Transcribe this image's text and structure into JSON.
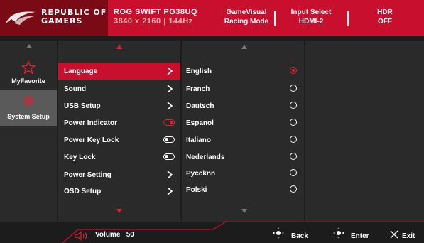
{
  "header": {
    "brand": [
      "REPUBLIC OF",
      "GAMERS"
    ],
    "model": "ROG SWIFT PG38UQ",
    "model_sub": "3840 x 2160 | 144Hz",
    "status": [
      {
        "line1": "GameVisual",
        "line2": "Racing Mode"
      },
      {
        "line1": "Input Select",
        "line2": "HDMI-2"
      },
      {
        "line1": "HDR",
        "line2": "OFF"
      }
    ]
  },
  "categories": [
    {
      "label": "MyFavorite",
      "icon": "star-icon",
      "active": false
    },
    {
      "label": "System Setup",
      "icon": "gear-icon",
      "active": true
    }
  ],
  "menu": [
    {
      "label": "Language",
      "control": "chevron",
      "active": true
    },
    {
      "label": "Sound",
      "control": "chevron"
    },
    {
      "label": "USB Setup",
      "control": "chevron"
    },
    {
      "label": "Power Indicator",
      "control": "toggle",
      "on": true
    },
    {
      "label": "Power Key Lock",
      "control": "toggle",
      "on": false
    },
    {
      "label": "Key Lock",
      "control": "toggle",
      "on": false
    },
    {
      "label": "Power Setting",
      "control": "chevron"
    },
    {
      "label": "OSD Setup",
      "control": "chevron"
    }
  ],
  "options": [
    {
      "label": "English",
      "selected": true
    },
    {
      "label": "Franch",
      "selected": false
    },
    {
      "label": "Dautsch",
      "selected": false
    },
    {
      "label": "Espanol",
      "selected": false
    },
    {
      "label": "Italiano",
      "selected": false
    },
    {
      "label": "Nederlands",
      "selected": false
    },
    {
      "label": "Pyccknn",
      "selected": false
    },
    {
      "label": "Polski",
      "selected": false
    }
  ],
  "footer": {
    "volume_label": "Volume",
    "volume_value": "50",
    "back": "Back",
    "enter": "Enter",
    "exit": "Exit"
  },
  "colors": {
    "accent": "#c8102e",
    "panel": "#2a2a2a",
    "background": "#1c1c1c"
  }
}
